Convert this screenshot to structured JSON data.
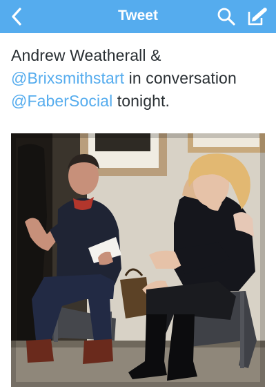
{
  "header": {
    "title": "Tweet",
    "background": "#55acee",
    "icons": {
      "back": "chevron-left-icon",
      "search": "search-icon",
      "compose": "compose-icon"
    }
  },
  "tweet": {
    "text_start": "Andrew Weatherall &",
    "mention_1": "@Brixsmithstart",
    "text_middle": " in conversation",
    "mention_2": "@FaberSocial",
    "text_end": " tonight.",
    "photo": {
      "description_icon": "photo-icon"
    }
  },
  "colors": {
    "accent": "#55acee",
    "text": "#292f33"
  }
}
